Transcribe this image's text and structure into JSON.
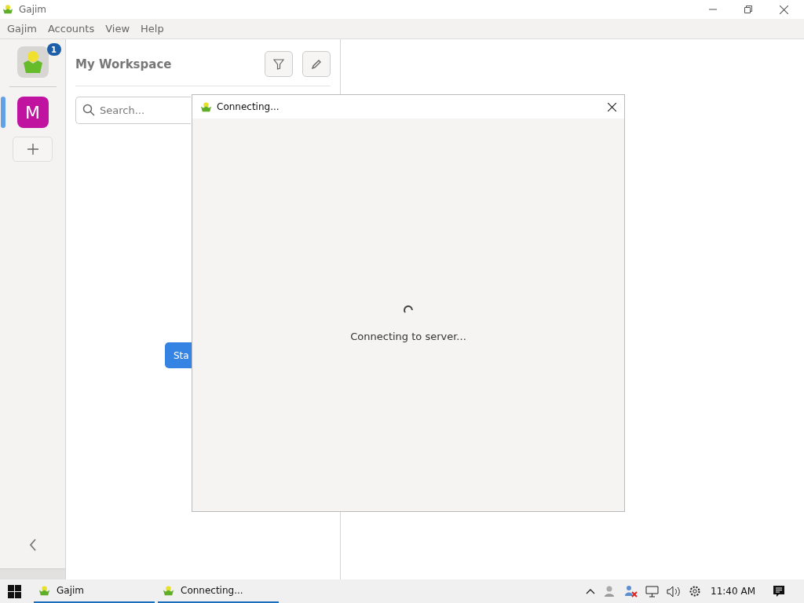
{
  "window": {
    "title": "Gajim"
  },
  "menu": [
    "Gajim",
    "Accounts",
    "View",
    "Help"
  ],
  "sidebar": {
    "workspace_badge": "1",
    "accounts": [
      {
        "letter": "M",
        "color": "#c0139f",
        "selected": true
      }
    ]
  },
  "workspace": {
    "title": "My Workspace",
    "search": {
      "placeholder": "Search..."
    },
    "start_button": "Sta"
  },
  "dialog": {
    "title": "Connecting...",
    "status": "Connecting to server..."
  },
  "taskbar": {
    "items": [
      {
        "label": "Gajim"
      },
      {
        "label": "Connecting..."
      }
    ],
    "clock": "11:40 AM"
  }
}
